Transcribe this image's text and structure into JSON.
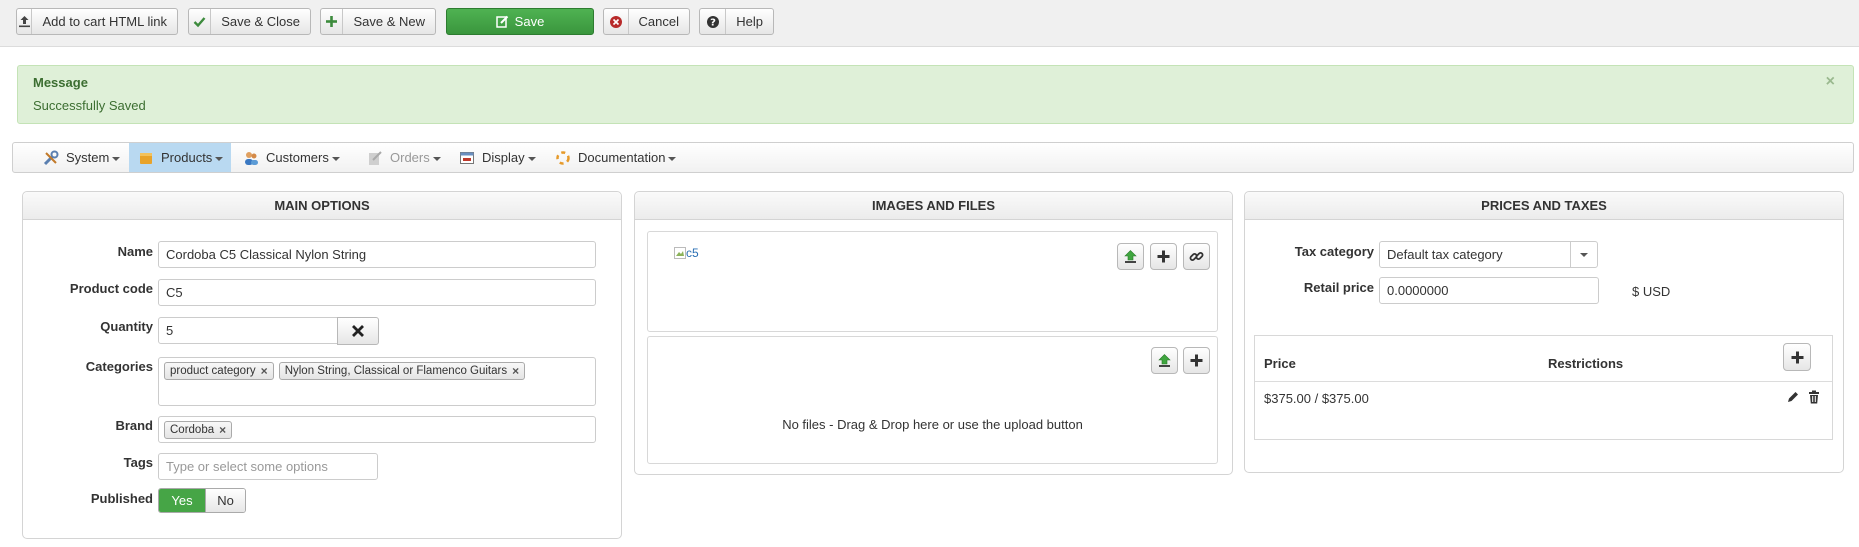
{
  "toolbar": {
    "add_cart_label": "Add to cart HTML link",
    "save_close_label": "Save & Close",
    "save_new_label": "Save & New",
    "save_label": "Save",
    "cancel_label": "Cancel",
    "help_label": "Help"
  },
  "message": {
    "title": "Message",
    "body": "Successfully Saved",
    "close_glyph": "×"
  },
  "menu": {
    "system": "System",
    "products": "Products",
    "customers": "Customers",
    "orders": "Orders",
    "display": "Display",
    "documentation": "Documentation"
  },
  "main_options": {
    "title": "MAIN OPTIONS",
    "name_label": "Name",
    "name_value": "Cordoba C5 Classical Nylon String",
    "code_label": "Product code",
    "code_value": "C5",
    "quantity_label": "Quantity",
    "quantity_value": "5",
    "categories_label": "Categories",
    "categories": [
      "product category",
      "Nylon String, Classical or Flamenco Guitars"
    ],
    "brand_label": "Brand",
    "brand_value": "Cordoba",
    "tags_label": "Tags",
    "tags_placeholder": "Type or select some options",
    "published_label": "Published",
    "yes_label": "Yes",
    "no_label": "No"
  },
  "images_files": {
    "title": "IMAGES AND FILES",
    "image_alt": "c5",
    "no_files_text": "No files - Drag & Drop here or use the upload button"
  },
  "prices_taxes": {
    "title": "PRICES AND TAXES",
    "tax_label": "Tax category",
    "tax_value": "Default tax category",
    "retail_label": "Retail price",
    "retail_value": "0.0000000",
    "currency": "$ USD",
    "col_price": "Price",
    "col_restrictions": "Restrictions",
    "rows": [
      {
        "price": "$375.00 / $375.00",
        "restrictions": ""
      }
    ]
  },
  "colors": {
    "save_green": "#46a546",
    "message_bg": "#dff0d8",
    "menu_active": "#b9d9f1"
  }
}
